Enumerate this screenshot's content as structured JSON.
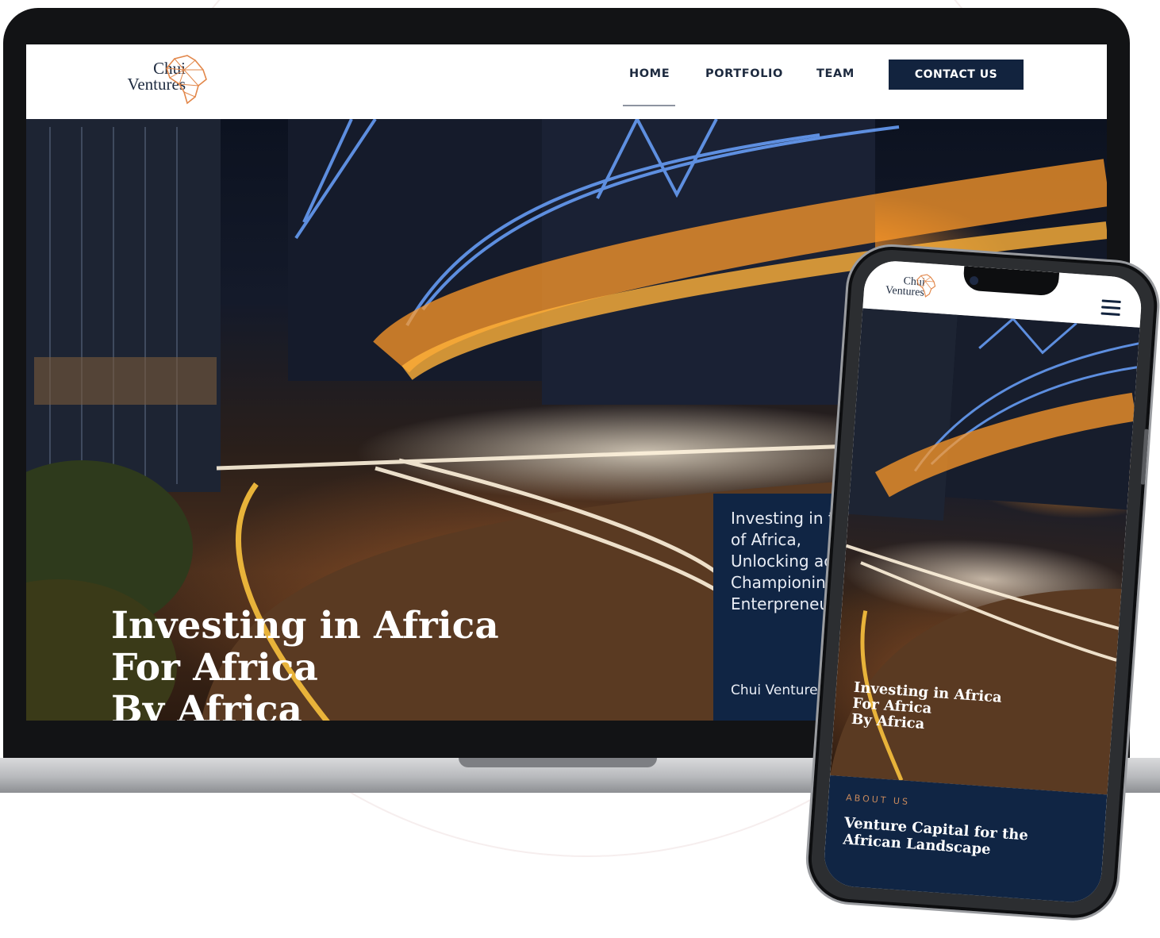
{
  "laptop": {
    "logo": {
      "line1": "Chui",
      "line2": "Ventures"
    },
    "nav": {
      "items": [
        {
          "label": "HOME",
          "active": true
        },
        {
          "label": "PORTFOLIO"
        },
        {
          "label": "TEAM"
        }
      ],
      "cta": "CONTACT US"
    },
    "hero": {
      "title_lines": [
        "Investing in Africa",
        "For Africa",
        "By Africa"
      ],
      "panel_lines": [
        "Investing in the",
        "of Africa,",
        "Unlocking acc",
        "Championing",
        "Enterpreneurs"
      ],
      "panel_footer": "Chui Ventures,"
    }
  },
  "phone": {
    "logo": {
      "line1": "Chui",
      "line2": "Ventures"
    },
    "menu_icon": "hamburger-icon",
    "hero": {
      "title_lines": [
        "Investing in Africa",
        "For Africa",
        "By Africa"
      ]
    },
    "about": {
      "label": "ABOUT US",
      "title_lines": [
        "Venture Capital for the",
        "African Landscape"
      ]
    }
  },
  "colors": {
    "navy": "#12233e",
    "panel": "#102544",
    "accent": "#c98a5c",
    "logo_orange": "#e2874a"
  }
}
